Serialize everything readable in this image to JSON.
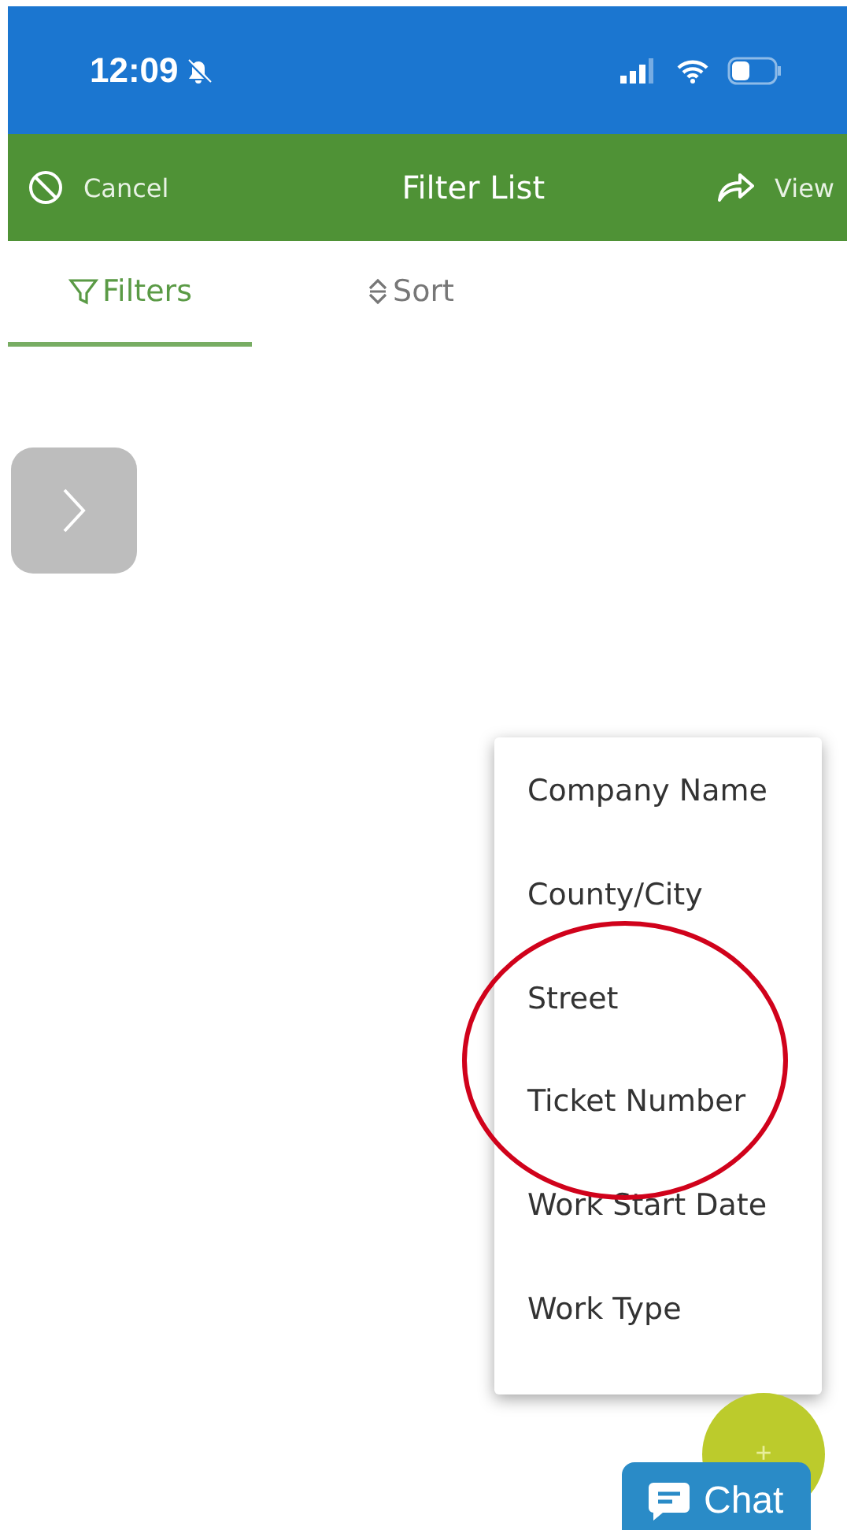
{
  "status_bar": {
    "time": "12:09"
  },
  "header": {
    "cancel": "Cancel",
    "title": "Filter List",
    "view": "View"
  },
  "tabs": [
    {
      "label": "Filters",
      "selected": true,
      "kind": "filter"
    },
    {
      "label": "Sort",
      "selected": false,
      "kind": "sort"
    }
  ],
  "menu": {
    "items": [
      "Company Name",
      "County/City",
      "Street",
      "Ticket Number",
      "Work Start Date",
      "Work Type"
    ]
  },
  "fab": {
    "label": "+"
  },
  "chat": {
    "label": "Chat"
  }
}
